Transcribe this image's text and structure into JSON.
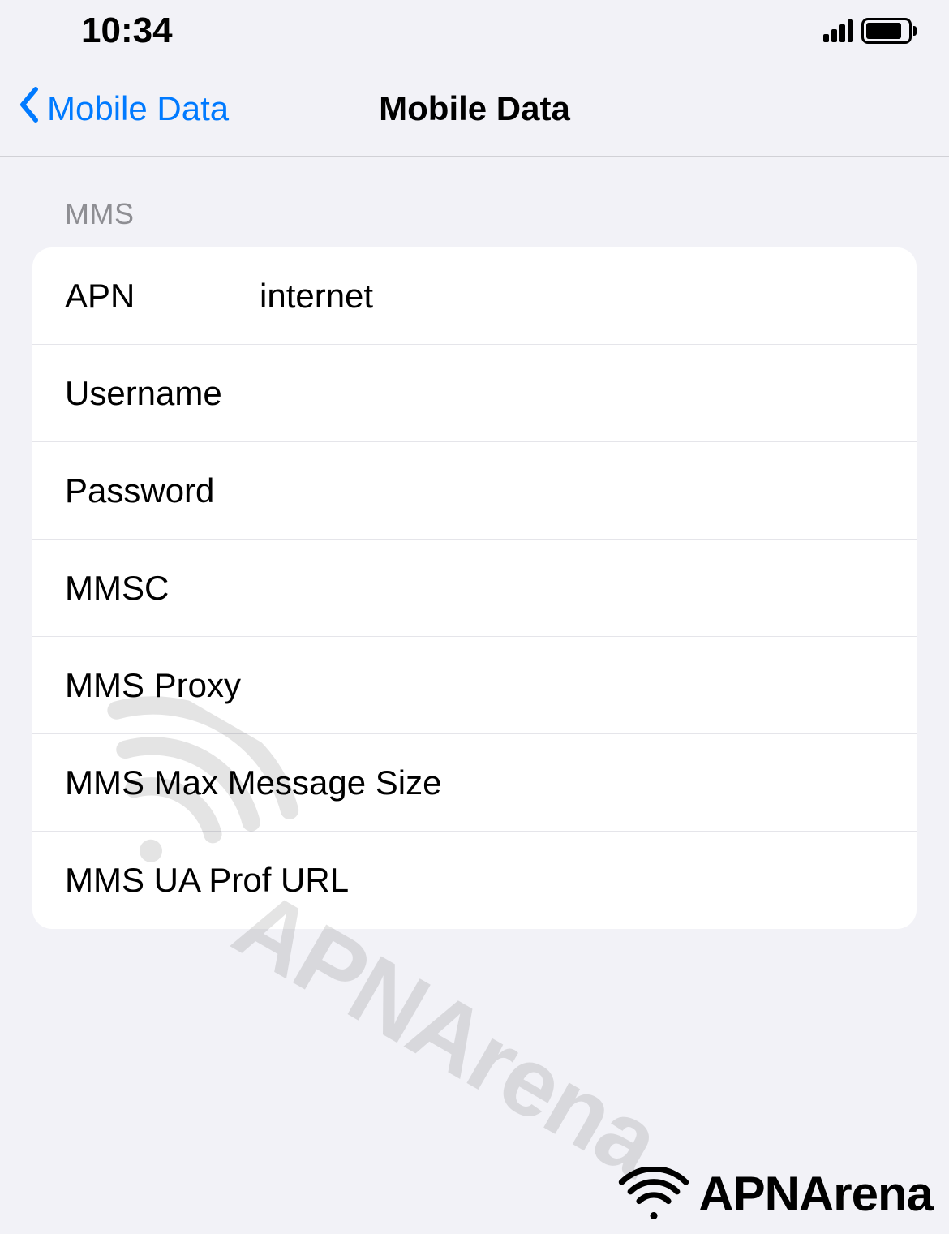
{
  "statusBar": {
    "time": "10:34"
  },
  "navBar": {
    "backLabel": "Mobile Data",
    "title": "Mobile Data"
  },
  "section": {
    "header": "MMS"
  },
  "fields": {
    "apn": {
      "label": "APN",
      "value": "internet"
    },
    "username": {
      "label": "Username",
      "value": ""
    },
    "password": {
      "label": "Password",
      "value": ""
    },
    "mmsc": {
      "label": "MMSC",
      "value": ""
    },
    "mmsProxy": {
      "label": "MMS Proxy",
      "value": ""
    },
    "mmsMaxSize": {
      "label": "MMS Max Message Size",
      "value": ""
    },
    "mmsUaProf": {
      "label": "MMS UA Prof URL",
      "value": ""
    }
  },
  "brand": {
    "name": "APNArena"
  }
}
